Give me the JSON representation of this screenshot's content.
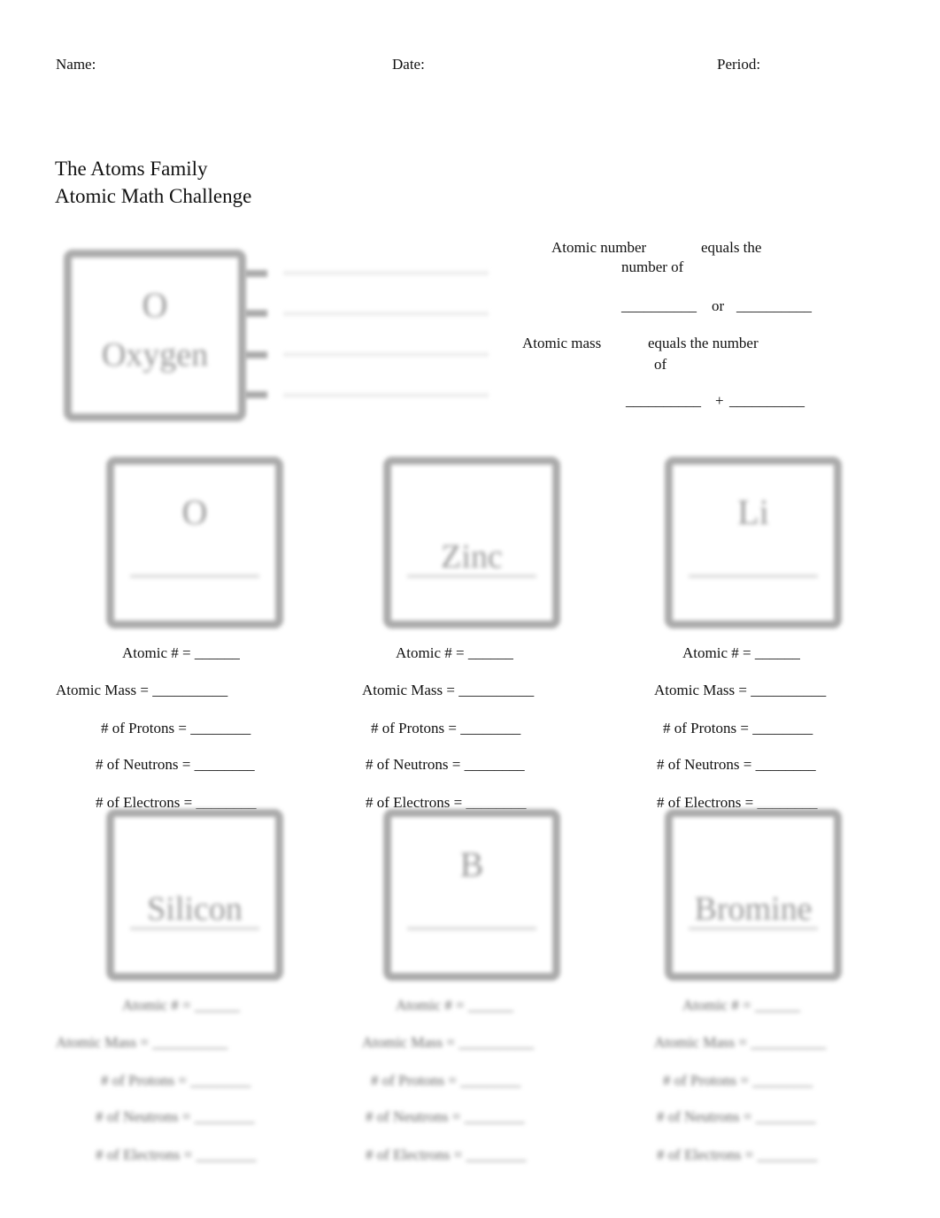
{
  "header": {
    "name": "Name:",
    "date": "Date:",
    "period": "Period:"
  },
  "title": {
    "line1": "The Atoms Family",
    "line2": "Atomic Math Challenge"
  },
  "definitions": {
    "atomic_number": "Atomic number",
    "equals_the": "equals the",
    "number_of": "number of",
    "blank1": "__________",
    "or": "or",
    "blank2": "__________",
    "atomic_mass": "Atomic mass",
    "equals_the_number": "equals the number",
    "of": "of",
    "blank3": "__________",
    "plus": "+",
    "blank4": "__________"
  },
  "example_element": {
    "symbol": "O",
    "name": "Oxygen"
  },
  "elements": [
    {
      "symbol": "O",
      "name": ""
    },
    {
      "symbol": "",
      "name": "Zinc"
    },
    {
      "symbol": "Li",
      "name": ""
    },
    {
      "symbol": "",
      "name": "Silicon"
    },
    {
      "symbol": "B",
      "name": ""
    },
    {
      "symbol": "",
      "name": "Bromine"
    }
  ],
  "fields": {
    "atomic_num": "Atomic # = ______",
    "atomic_mass": "Atomic Mass = __________",
    "protons": "# of Protons = ________",
    "neutrons": "# of Neutrons = ________",
    "electrons": "# of Electrons = ________"
  }
}
